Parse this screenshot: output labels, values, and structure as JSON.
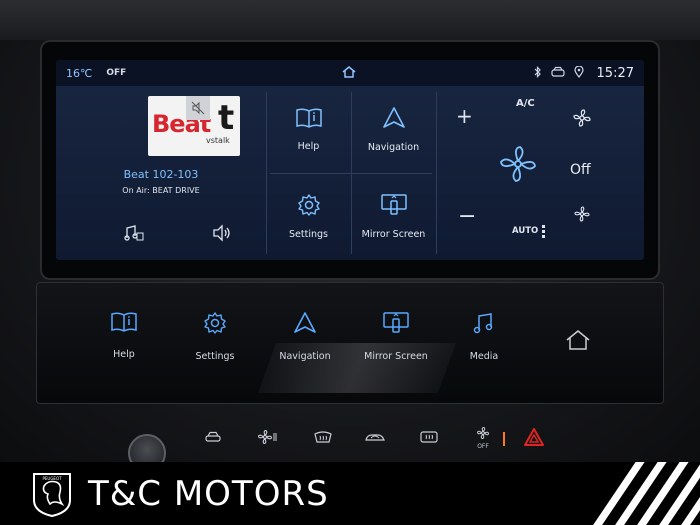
{
  "status": {
    "temperature": "16℃",
    "ac_state": "OFF",
    "time": "15:27"
  },
  "radio": {
    "station": "Beat 102-103",
    "on_air": "On Air: BEAT DRIVE",
    "logo_text": "Beat",
    "logo_suffix": "t",
    "logo_sub": "vstalk"
  },
  "shortcuts": [
    {
      "label": "Help",
      "icon": "book-info-icon"
    },
    {
      "label": "Navigation",
      "icon": "navigation-arrow-icon"
    },
    {
      "label": "Settings",
      "icon": "gear-icon"
    },
    {
      "label": "Mirror Screen",
      "icon": "mirror-screen-icon"
    }
  ],
  "climate": {
    "ac_label": "A/C",
    "plus": "+",
    "minus": "−",
    "fan_state": "Off",
    "auto_label": "AUTO"
  },
  "strip": [
    {
      "label": "Help",
      "icon": "book-info-icon"
    },
    {
      "label": "Settings",
      "icon": "gear-icon"
    },
    {
      "label": "Navigation",
      "icon": "navigation-arrow-icon"
    },
    {
      "label": "Mirror Screen",
      "icon": "mirror-screen-icon"
    },
    {
      "label": "Media",
      "icon": "music-note-icon"
    },
    {
      "label": "",
      "icon": "home-icon"
    }
  ],
  "hardware": {
    "rear_demist_label": "OFF"
  },
  "banner": {
    "brand": "T&C MOTORS"
  },
  "colors": {
    "accent": "#7fc0ff",
    "screen_bg": "#14213b",
    "hazard": "#e0241f"
  }
}
